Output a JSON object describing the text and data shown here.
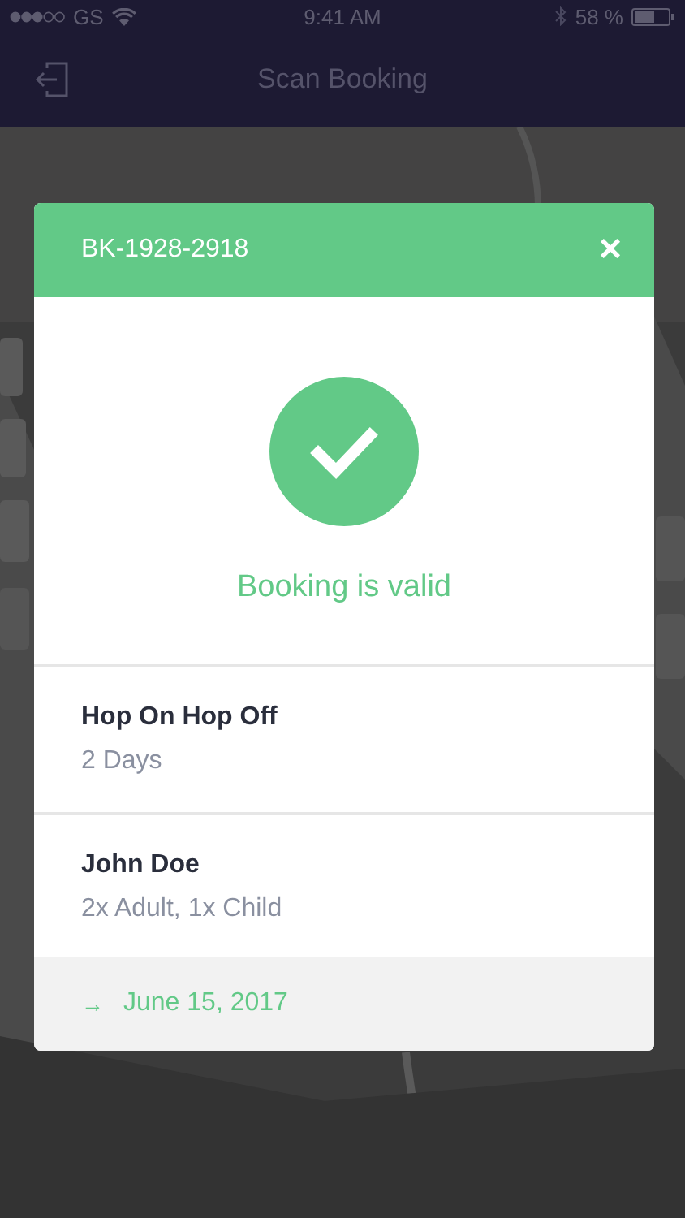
{
  "status_bar": {
    "carrier": "GS",
    "time": "9:41 AM",
    "battery": "58 %"
  },
  "nav_bar": {
    "title": "Scan Booking"
  },
  "dialog": {
    "booking_id": "BK-1928-2918",
    "close": "×",
    "status": {
      "kind": "valid",
      "message": "Booking is valid"
    },
    "items": [
      {
        "title": "Hop On Hop Off",
        "subtitle": "2 Days"
      },
      {
        "title": "John Doe",
        "subtitle": "2x Adult, 1x Child"
      }
    ],
    "footer": {
      "arrow": "→",
      "date": "June 15, 2017"
    }
  }
}
